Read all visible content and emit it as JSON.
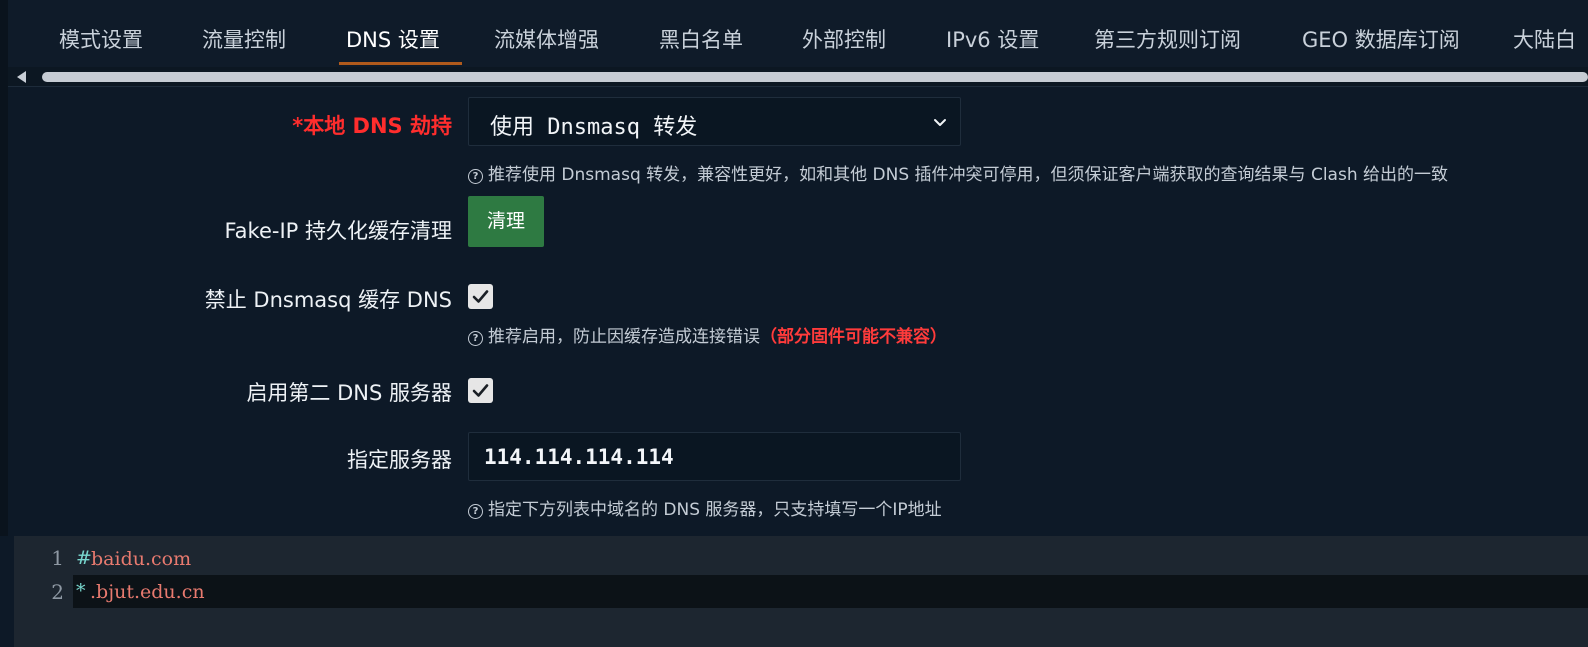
{
  "tabs": [
    {
      "label": "模式设置"
    },
    {
      "label": "流量控制"
    },
    {
      "label": "DNS 设置",
      "active": true
    },
    {
      "label": "流媒体增强"
    },
    {
      "label": "黑白名单"
    },
    {
      "label": "外部控制"
    },
    {
      "label": "IPv6 设置"
    },
    {
      "label": "第三方规则订阅"
    },
    {
      "label": "GEO 数据库订阅"
    },
    {
      "label": "大陆白"
    }
  ],
  "form": {
    "dns_hijack": {
      "label": "*本地 DNS 劫持",
      "value": "使用 Dnsmasq 转发",
      "help": "推荐使用 Dnsmasq 转发，兼容性更好，如和其他 DNS 插件冲突可停用，但须保证客户端获取的查询结果与 Clash 给出的一致"
    },
    "fakeip_clear": {
      "label": "Fake-IP 持久化缓存清理",
      "button_label": "清理"
    },
    "dnsmasq_cache": {
      "label": "禁止 Dnsmasq 缓存 DNS",
      "checked": true,
      "help": "推荐启用，防止因缓存造成连接错误",
      "help_warn": "（部分固件可能不兼容）"
    },
    "second_dns": {
      "label": "启用第二 DNS 服务器",
      "checked": true
    },
    "server": {
      "label": "指定服务器",
      "value": "114.114.114.114",
      "help": "指定下方列表中域名的 DNS 服务器，只支持填写一个IP地址"
    },
    "help_icon": "question-circle-icon"
  },
  "editor": {
    "lines": [
      {
        "number": "1",
        "prefix": "#",
        "text": "baidu.com"
      },
      {
        "number": "2",
        "prefix": "*",
        "text": ".bjut.edu.cn"
      }
    ]
  },
  "colors": {
    "background": "#0d1927",
    "accent_underline": "#b05a1c",
    "button_green": "#2e7a42",
    "required_red": "#ff2d2d",
    "code_prefix": "#78d7ce",
    "code_text": "#e87a6f"
  }
}
